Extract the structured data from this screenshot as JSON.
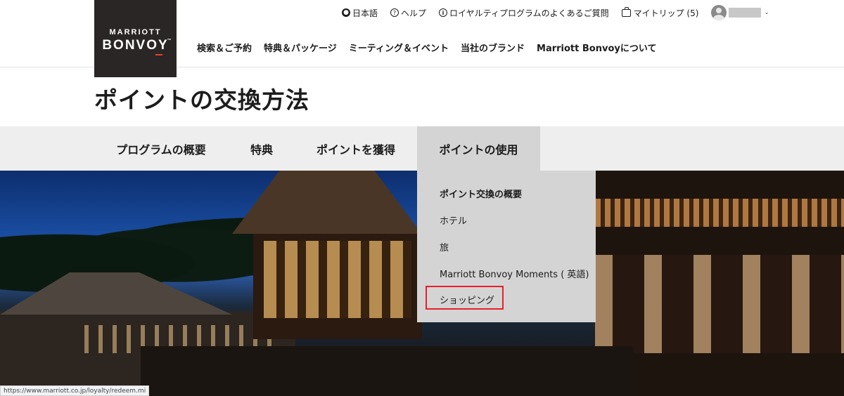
{
  "logo": {
    "line1": "MARRIOTT",
    "line2": "BONVOY",
    "tm": "™"
  },
  "utility_nav": {
    "language": "日本語",
    "help": "ヘルプ",
    "faq": "ロイヤルティプログラムのよくあるご質問",
    "my_trips": "マイトリップ (5)"
  },
  "main_nav": [
    "検索＆ご予約",
    "特典＆パッケージ",
    "ミーティング＆イベント",
    "当社のブランド",
    "Marriott Bonvoyについて"
  ],
  "page_title": "ポイントの交換方法",
  "sub_nav": {
    "tabs": [
      "プログラムの概要",
      "特典",
      "ポイントを獲得",
      "ポイントの使用"
    ],
    "active": "ポイントの使用"
  },
  "dropdown": {
    "items": [
      "ポイント交換の概要",
      "ホテル",
      "旅",
      "Marriott Bonvoy Moments ( 英語)",
      "ショッピング"
    ],
    "highlighted": "ショッピング"
  },
  "status_bar": {
    "url": "https://www.marriott.co.jp/loyalty/redeem.mi"
  },
  "colors": {
    "logo_bg": "#2a2625",
    "highlight_border": "#e8202a",
    "subnav_bg": "#eeeeee",
    "active_tab_bg": "#d4d4d4"
  }
}
